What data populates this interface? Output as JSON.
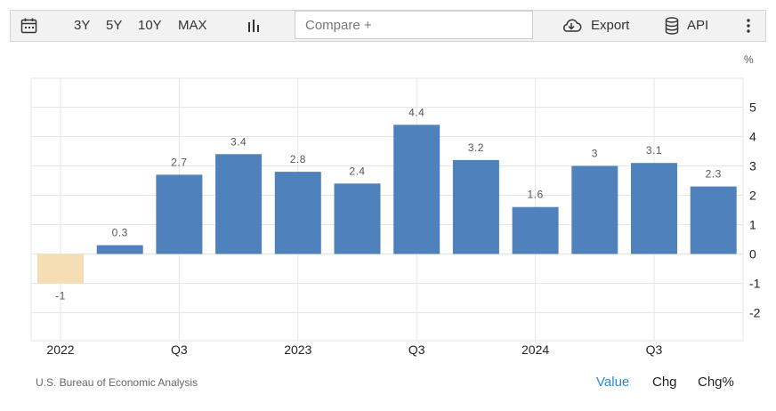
{
  "toolbar": {
    "ranges": [
      "3Y",
      "5Y",
      "10Y",
      "MAX"
    ],
    "compare_placeholder": "Compare +",
    "export_label": "Export",
    "api_label": "API",
    "icons": [
      "calendar-icon",
      "bar-chart-icon",
      "cloud-download-icon",
      "database-icon",
      "more-vertical-icon"
    ]
  },
  "unit_label": "%",
  "footer": {
    "source": "U.S. Bureau of Economic Analysis",
    "tabs": [
      "Value",
      "Chg",
      "Chg%"
    ],
    "active_tab": "Value"
  },
  "chart_data": {
    "type": "bar",
    "categories": [
      "2022 Q1",
      "2022 Q2",
      "2022 Q3",
      "2022 Q4",
      "2023 Q1",
      "2023 Q2",
      "2023 Q3",
      "2023 Q4",
      "2024 Q1",
      "2024 Q2",
      "2024 Q3",
      "2024 Q4"
    ],
    "values": [
      -1,
      0.3,
      2.7,
      3.4,
      2.8,
      2.4,
      4.4,
      3.2,
      1.6,
      3,
      3.1,
      2.3
    ],
    "data_labels": [
      "-1",
      "0.3",
      "2.7",
      "3.4",
      "2.8",
      "2.4",
      "4.4",
      "3.2",
      "1.6",
      "3",
      "3.1",
      "2.3"
    ],
    "x_tick_labels": [
      {
        "index": 0,
        "label": "2022"
      },
      {
        "index": 2,
        "label": "Q3"
      },
      {
        "index": 4,
        "label": "2023"
      },
      {
        "index": 6,
        "label": "Q3"
      },
      {
        "index": 8,
        "label": "2024"
      },
      {
        "index": 10,
        "label": "Q3"
      }
    ],
    "y_ticks": [
      5,
      4,
      3,
      2,
      1,
      0,
      -1,
      -2
    ],
    "ylim": [
      -3,
      6
    ],
    "grid": true,
    "colors": {
      "positive": "#4f81bd",
      "negative": "#f5deb3",
      "grid": "#e6e6e6"
    }
  }
}
